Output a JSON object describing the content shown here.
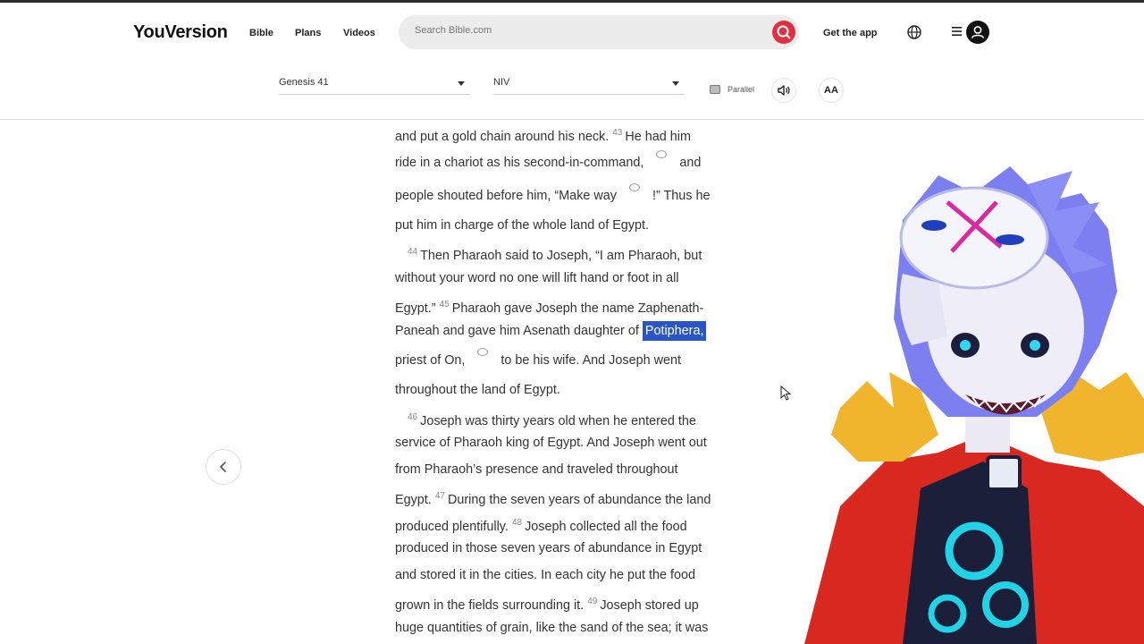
{
  "header": {
    "logo": "YouVersion",
    "nav": {
      "bible": "Bible",
      "plans": "Plans",
      "videos": "Videos"
    },
    "search_placeholder": "Search Bible.com",
    "get_app": "Get the app"
  },
  "toolbar": {
    "book_chapter": "Genesis 41",
    "version": "NIV",
    "parallel": "Parallel",
    "font_size": "AA"
  },
  "scripture": {
    "l1a": "and put a gold chain around his neck.",
    "v43": "43",
    "l1b": "He had him",
    "l2a": "ride in a chariot as his second-in-command,",
    "l2b": "and",
    "l3a": "people shouted before him, “Make way",
    "l3b": "!” Thus he",
    "l4": "put him in charge of the whole land of Egypt.",
    "v44": "44",
    "l5": "Then Pharaoh said to Joseph, “I am Pharaoh, but",
    "l6": "without your word no one will lift hand or foot in all",
    "l7a": "Egypt.”",
    "v45": "45",
    "l7b": "Pharaoh gave Joseph the name Zaphenath-",
    "l8a": "Paneah and gave him Asenath daughter of",
    "l8hl": "Potiphera,",
    "l9a": "priest of On,",
    "l9b": "to be his wife. And Joseph went",
    "l10": "throughout the land of Egypt.",
    "v46": "46",
    "l11": "Joseph was thirty years old when he entered the",
    "l12": "service of Pharaoh king of Egypt. And Joseph went out",
    "l13": "from Pharaoh’s presence and traveled throughout",
    "l14a": "Egypt.",
    "v47": "47",
    "l14b": "During the seven years of abundance the land",
    "l15a": "produced plentifully.",
    "v48": "48",
    "l15b": "Joseph collected all the food",
    "l16": "produced in those seven years of abundance in Egypt",
    "l17": "and stored it in the cities. In each city he put the food",
    "l18a": "grown in the fields surrounding it.",
    "v49": "49",
    "l18b": "Joseph stored up",
    "l19": "huge quantities of grain, like the sand of the sea; it was"
  },
  "colors": {
    "accent_red": "#e0303f",
    "highlight_blue": "#2a55c9"
  },
  "icons": {
    "search": "search-icon",
    "globe": "globe-icon",
    "menu": "menu-icon",
    "user": "user-icon",
    "audio": "speaker-icon",
    "note": "note-bubble-icon",
    "prev": "chevron-left-icon"
  }
}
